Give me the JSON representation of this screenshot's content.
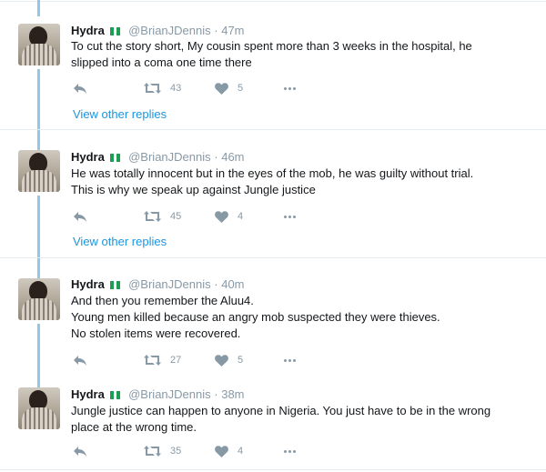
{
  "tweets": [
    {
      "name": "Hydra",
      "handle": "@BrianJDennis",
      "dot": "·",
      "time": "47m",
      "lines": [
        "To cut the story short, My cousin spent more than 3 weeks in the hospital, he",
        "slipped into a coma one time there"
      ],
      "retweets": "43",
      "likes": "5",
      "view_replies": "View other replies"
    },
    {
      "name": "Hydra",
      "handle": "@BrianJDennis",
      "dot": "·",
      "time": "46m",
      "lines": [
        "He was totally innocent but in the eyes of the mob, he was guilty without trial.",
        "This is why we speak up against Jungle justice"
      ],
      "retweets": "45",
      "likes": "4",
      "view_replies": "View other replies"
    },
    {
      "name": "Hydra",
      "handle": "@BrianJDennis",
      "dot": "·",
      "time": "40m",
      "lines": [
        "And then you remember the Aluu4.",
        "Young men killed because an angry mob suspected they were thieves.",
        "No stolen items were recovered."
      ],
      "retweets": "27",
      "likes": "5"
    },
    {
      "name": "Hydra",
      "handle": "@BrianJDennis",
      "dot": "·",
      "time": "38m",
      "lines": [
        "Jungle justice can happen to anyone in Nigeria. You just have to be in the wrong",
        "place at the wrong time."
      ],
      "retweets": "35",
      "likes": "4"
    }
  ],
  "icons": {
    "reply": "reply-icon",
    "retweet": "retweet-icon",
    "like": "heart-icon",
    "more": "more-icon",
    "flag": "nigeria-flag-icon"
  },
  "colors": {
    "link": "#1b95e0",
    "muted": "#8899a6",
    "thread_line": "#91c7e8",
    "flag_green": "#1e9e52"
  }
}
